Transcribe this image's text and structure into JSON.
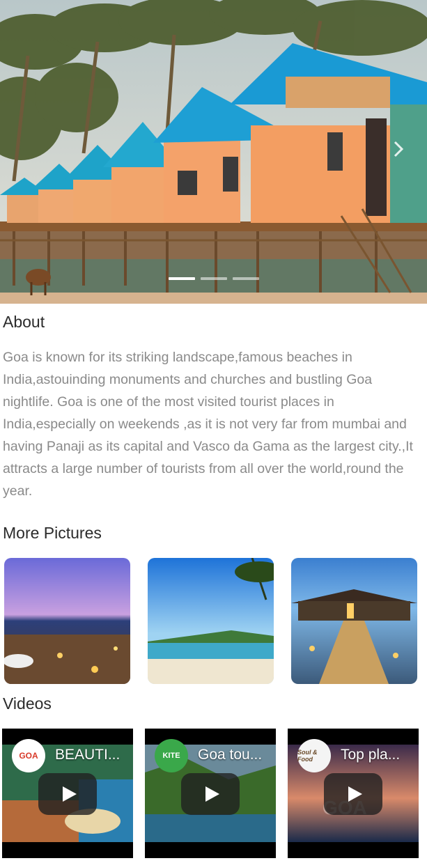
{
  "hero": {
    "slides": 3,
    "active_slide": 1,
    "next_icon": "chevron-right-icon"
  },
  "about": {
    "title": "About",
    "text": "Goa is known for its striking landscape,famous beaches in India,astouinding monuments and churches and bustling Goa nightlife. Goa is one of the most visited tourist places in India,especially on weekends ,as it is not very far from mumbai and having Panaji as its capital and Vasco da Gama as the largest city.,It attracts a large number of tourists from all over the world,round the year."
  },
  "more_pictures": {
    "title": "More Pictures",
    "items": [
      "beach-night-dinner",
      "palm-beach",
      "lit-pier-resort"
    ]
  },
  "videos": {
    "title": "Videos",
    "items": [
      {
        "title": "BEAUTI...",
        "channel_badge": "GOA",
        "play_icon": "play-icon"
      },
      {
        "title": "Goa tou...",
        "channel_badge": "KITE",
        "play_icon": "play-icon"
      },
      {
        "title": "Top pla...",
        "channel_badge": "Soul & Food",
        "play_icon": "play-icon"
      }
    ]
  },
  "colors": {
    "roof_blue": "#1e9fd4",
    "hut_wall": "#f0a06a",
    "body_text": "#8a8a8a",
    "heading_text": "#2b2b2b"
  }
}
